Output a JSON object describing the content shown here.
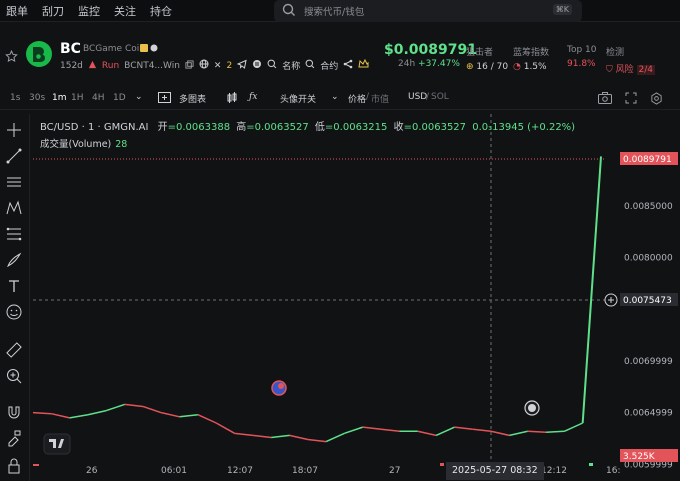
{
  "topnav": {
    "items": [
      "跟单",
      "刮刀",
      "监控",
      "关注",
      "持仓"
    ]
  },
  "search": {
    "placeholder": "搜索代币/钱包",
    "shortcut": "⌘K"
  },
  "token": {
    "symbol": "BC",
    "name": "BCGame Coin",
    "age": "152d",
    "run_label": "Run",
    "pair_short": "BCNT4...Win",
    "x_count": "2",
    "name_link": "名称",
    "contract_link": "合约",
    "price": "$0.0089791",
    "change_label": "24h",
    "change_value": "+37.47%"
  },
  "stats": {
    "snipers": {
      "label": "狙击者",
      "value": "16 / 70"
    },
    "bluechip": {
      "label": "蓝筹指数",
      "value": "1.5%"
    },
    "top10": {
      "label": "Top 10",
      "value": "91.8%"
    },
    "audit": {
      "label": "检测",
      "risk_label": "风险",
      "risk_value": "2/4"
    }
  },
  "timeframes": [
    "1s",
    "30s",
    "1m",
    "1H",
    "4H",
    "1D"
  ],
  "active_timeframe": "1m",
  "chart_toolbar": {
    "multi_chart": "多图表",
    "avatar_switch": "头像开关",
    "price_label": "价格",
    "mcap_label": "市值",
    "currency": "USD",
    "currency_alt": "SOL"
  },
  "legend": {
    "pair": "BC/USD · 1 · GMGN.AI",
    "open_label": "开",
    "open": "=0.0063388",
    "high_label": "高",
    "high": "=0.0063527",
    "low_label": "低",
    "low": "=0.0063215",
    "close_label": "收",
    "close": "=0.0063527",
    "change": "0.0₃13945 (+0.22%)",
    "volume_label": "成交量(Volume)",
    "volume_value": "28"
  },
  "chart_data": {
    "type": "line",
    "ylim": [
      0.0061,
      0.0091
    ],
    "y_ticks": [
      "0.0085000",
      "0.0080000",
      "0.0069999",
      "0.0064999",
      "0.0059999"
    ],
    "price_tag": "0.0089791",
    "crosshair_tag": "0.0075473",
    "volume_tag": "3.525K",
    "x_ticks": [
      "26",
      "06:01",
      "12:07",
      "18:07",
      "27",
      "12:12",
      "16:"
    ],
    "x_selected": "2025-05-27  08:32",
    "series": [
      {
        "values": [
          0.0064999,
          0.00649,
          0.00645,
          0.00648,
          0.00652,
          0.00658,
          0.00656,
          0.0065,
          0.00646,
          0.00648,
          0.0064,
          0.0063,
          0.00628,
          0.00626,
          0.00628,
          0.00624,
          0.00622,
          0.0063,
          0.00636,
          0.00634,
          0.00632,
          0.00632,
          0.00628,
          0.00636,
          0.00634,
          0.00632,
          0.00628,
          0.00632,
          0.00631,
          0.00632,
          0.0064,
          0.0089791
        ]
      }
    ]
  },
  "colors": {
    "up": "#5fe08a",
    "down": "#e2545a",
    "price_line": "#e2545a"
  }
}
